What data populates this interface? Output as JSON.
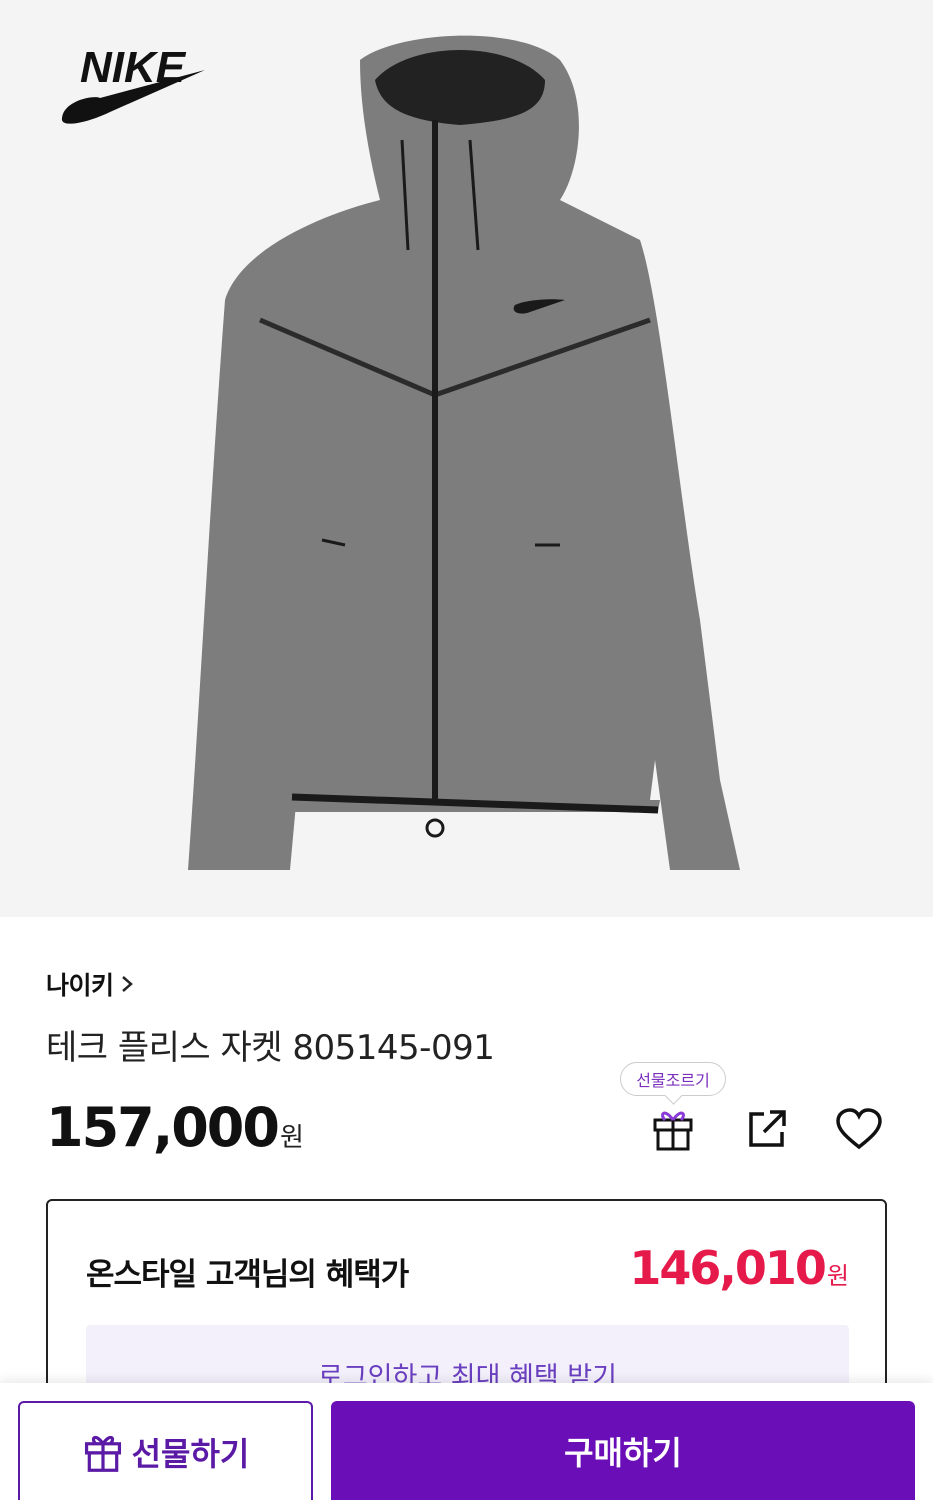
{
  "product": {
    "brand": "나이키",
    "name": "테크 플리스 자켓 805145-091",
    "price": "157,000",
    "currency": "원",
    "image_logo_text": "NIKE"
  },
  "actions": {
    "gift_tooltip": "선물조르기",
    "gift_icon": "gift-icon",
    "share_icon": "share-icon",
    "like_icon": "heart-icon"
  },
  "benefit": {
    "label": "온스타일 고객님의 혜택가",
    "price": "146,010",
    "currency": "원",
    "login_cta": "로그인하고 최대 혜택 받기"
  },
  "bottom_bar": {
    "gift_label": "선물하기",
    "buy_label": "구매하기"
  },
  "colors": {
    "accent_purple": "#6a0fb8",
    "benefit_price": "#e6194b"
  }
}
